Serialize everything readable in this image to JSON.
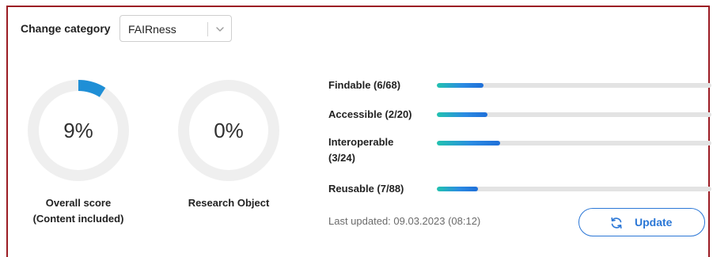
{
  "category": {
    "label": "Change category",
    "selected": "FAIRness"
  },
  "gauges": [
    {
      "value_text": "9%",
      "value": 0.09,
      "caption_line1": "Overall score",
      "caption_line2": "(Content included)"
    },
    {
      "value_text": "0%",
      "value": 0.0,
      "caption_line1": "Research Object",
      "caption_line2": ""
    }
  ],
  "metrics": [
    {
      "label_line1": "Findable (6/68)",
      "label_line2": "",
      "value": 0.17
    },
    {
      "label_line1": "Accessible (2/20)",
      "label_line2": "",
      "value": 0.185
    },
    {
      "label_line1": "Interoperable",
      "label_line2": "(3/24)",
      "value": 0.23
    },
    {
      "label_line1": "Reusable (7/88)",
      "label_line2": "",
      "value": 0.15
    }
  ],
  "last_updated": "Last updated: 09.03.2023 (08:12)",
  "update_button": {
    "label": "Update",
    "icon": "refresh-icon"
  },
  "colors": {
    "frame": "#9b1c24",
    "gauge_track": "#efefef",
    "gauge_fill": "#1f8fd6",
    "accent": "#2b77d6",
    "bar_track": "#e3e3e3"
  }
}
